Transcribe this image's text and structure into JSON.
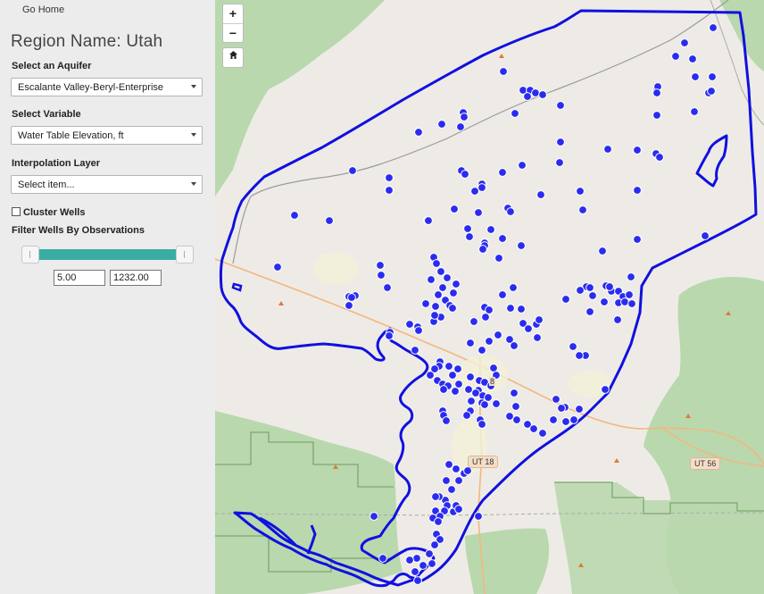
{
  "sidebar": {
    "home_link": "Go Home",
    "region_title": "Region Name: Utah",
    "aquifer_label": "Select an Aquifer",
    "aquifer_value": "Escalante Valley-Beryl-Enterprise",
    "variable_label": "Select Variable",
    "variable_value": "Water Table Elevation, ft",
    "interp_label": "Interpolation Layer",
    "interp_value": "Select item...",
    "cluster_label": "Cluster Wells",
    "filter_label": "Filter Wells By Observations",
    "min_value": "5.00",
    "max_value": "1232.00"
  },
  "map": {
    "zoom_in": "+",
    "zoom_out": "−",
    "home_icon": "house-icon",
    "road_labels": [
      "UT 18",
      "UT 56"
    ],
    "partial_label": "8",
    "colors": {
      "boundary": "#1010e0",
      "well_fill": "#2b2bf0",
      "well_stroke": "#ffffff",
      "road": "#f3b77d",
      "rail": "#9a9a9a",
      "green": "#b9d8ae",
      "land": "#eeebe6"
    }
  }
}
